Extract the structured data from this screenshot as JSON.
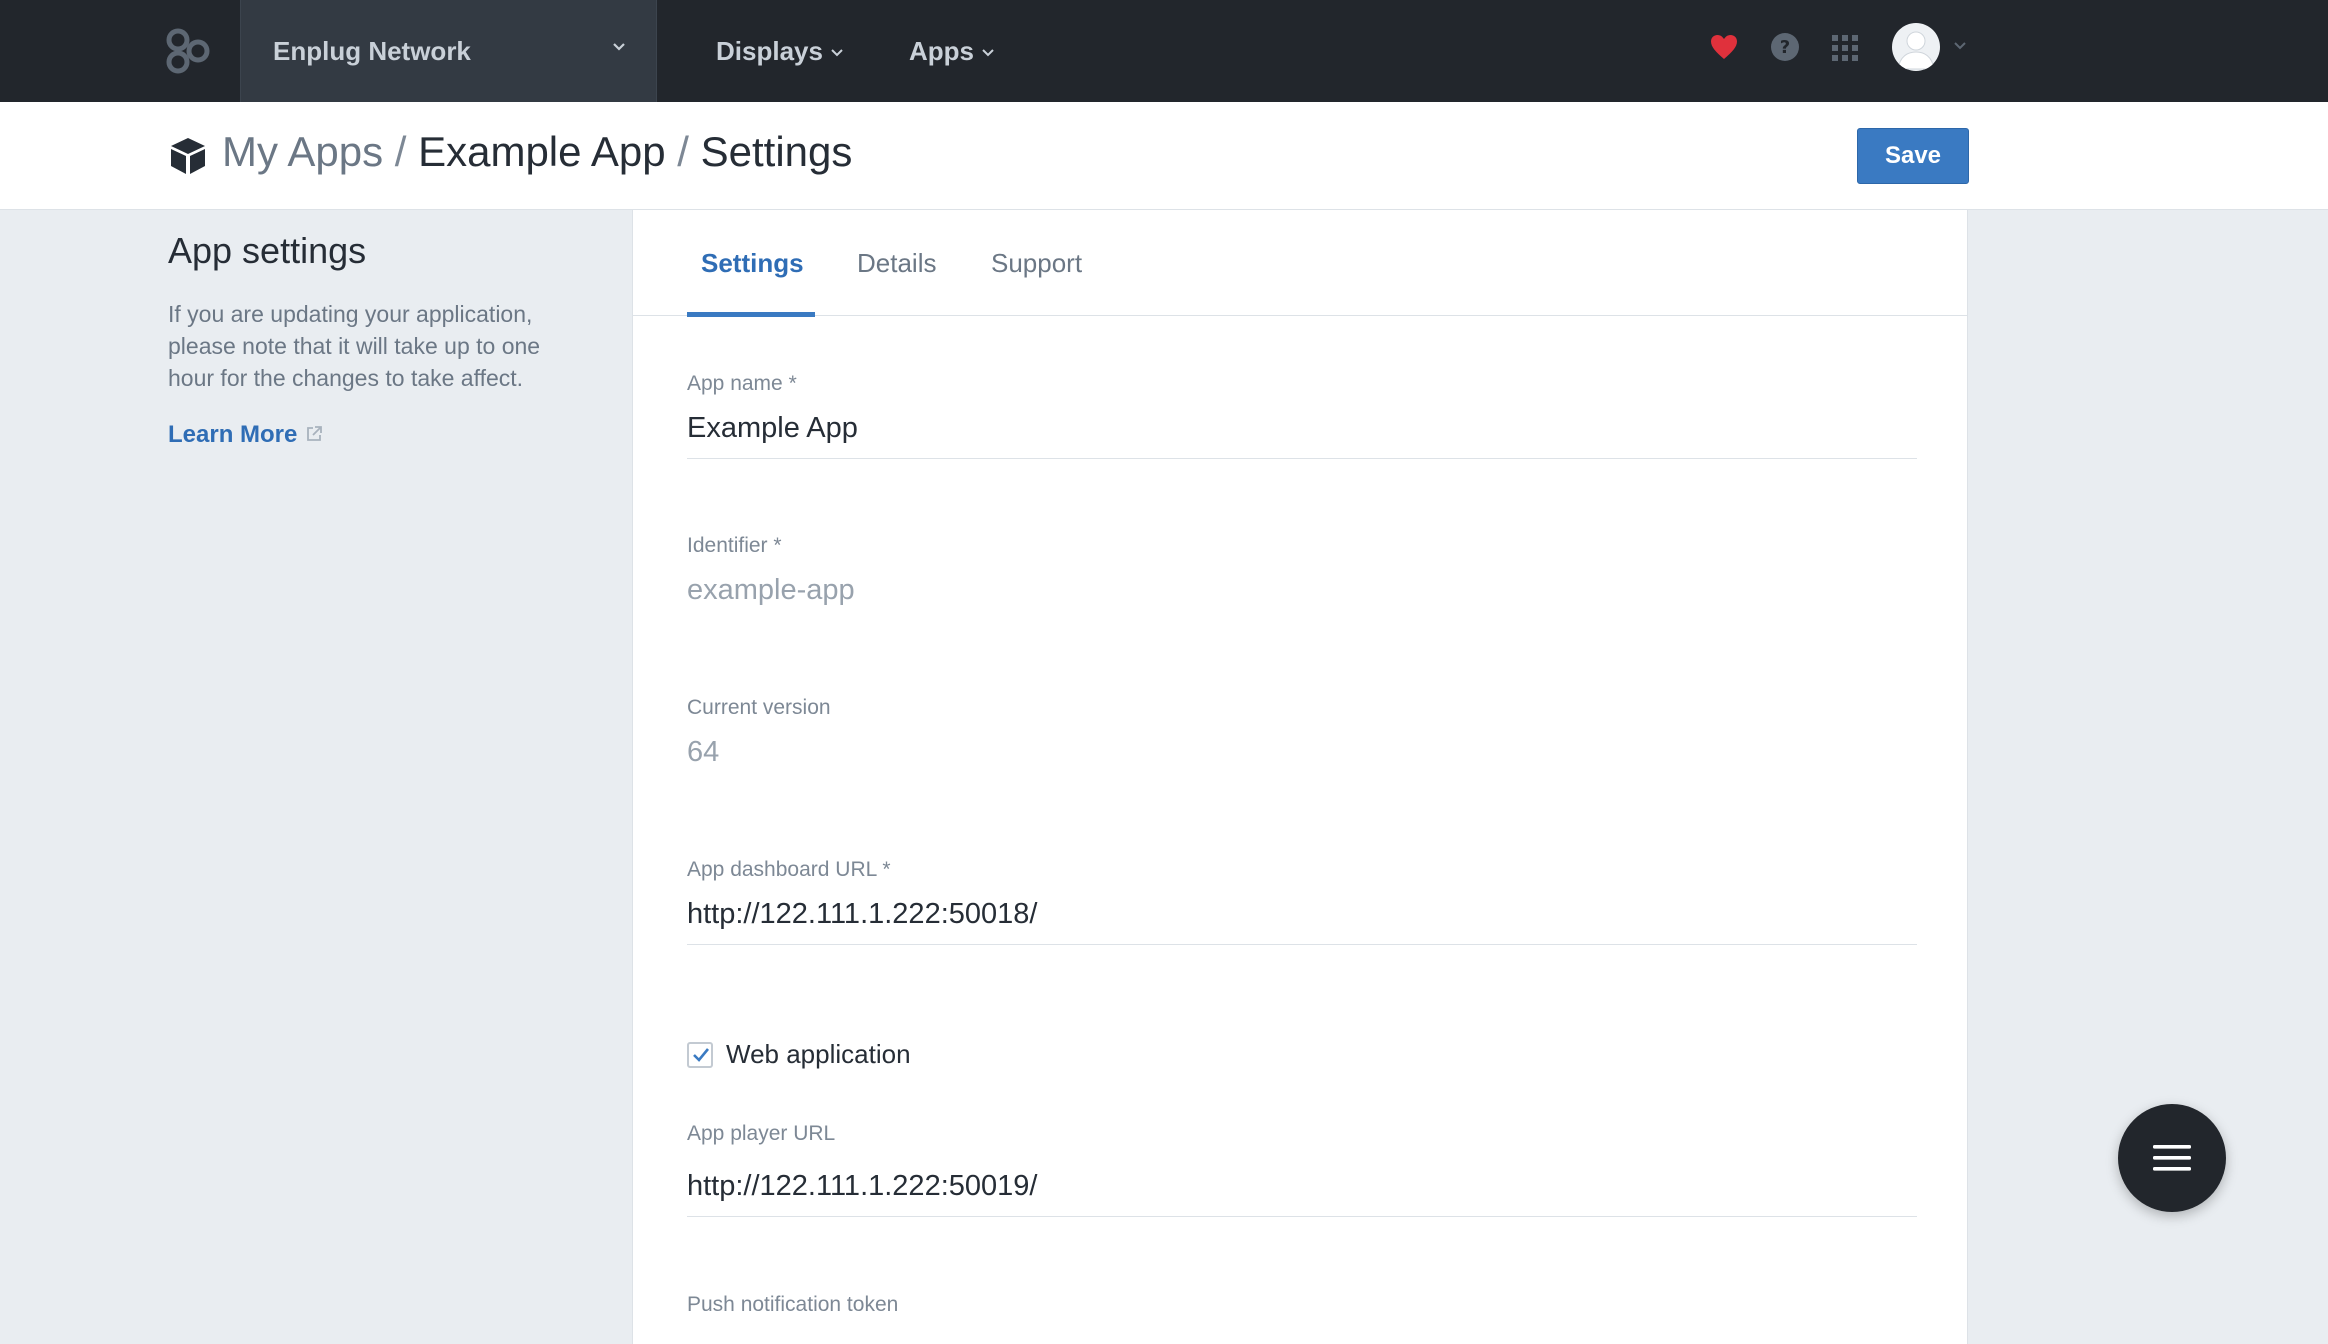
{
  "topnav": {
    "network_name": "Enplug Network",
    "links": [
      {
        "label": "Displays"
      },
      {
        "label": "Apps"
      }
    ],
    "icons": [
      "logo-icon",
      "chevron-down-icon",
      "heart-icon",
      "help-icon",
      "apps-grid-icon",
      "avatar",
      "chevron-down-icon"
    ],
    "heart_color": "#e0313c"
  },
  "header": {
    "breadcrumb": {
      "my_apps": "My Apps",
      "sep": "/",
      "app": "Example App",
      "current": "Settings"
    },
    "save_label": "Save"
  },
  "sidebar": {
    "title": "App settings",
    "description": "If you are updating your application, please note that it will take up to one hour for the changes to take affect.",
    "learn_more": "Learn More"
  },
  "tabs": [
    {
      "label": "Settings",
      "active": true
    },
    {
      "label": "Details",
      "active": false
    },
    {
      "label": "Support",
      "active": false
    }
  ],
  "form": {
    "app_name": {
      "label": "App name *",
      "value": "Example App"
    },
    "identifier": {
      "label": "Identifier *",
      "value": "example-app"
    },
    "current_version": {
      "label": "Current version",
      "value": "64"
    },
    "dashboard_url": {
      "label": "App dashboard URL *",
      "value": "http://122.111.1.222:50018/"
    },
    "web_application": {
      "label": "Web application",
      "checked": true
    },
    "player_url": {
      "label": "App player URL",
      "value": "http://122.111.1.222:50019/"
    },
    "push_token": {
      "label": "Push notification token"
    }
  },
  "colors": {
    "accent": "#3a7ac2",
    "nav_bg": "#22262c"
  }
}
